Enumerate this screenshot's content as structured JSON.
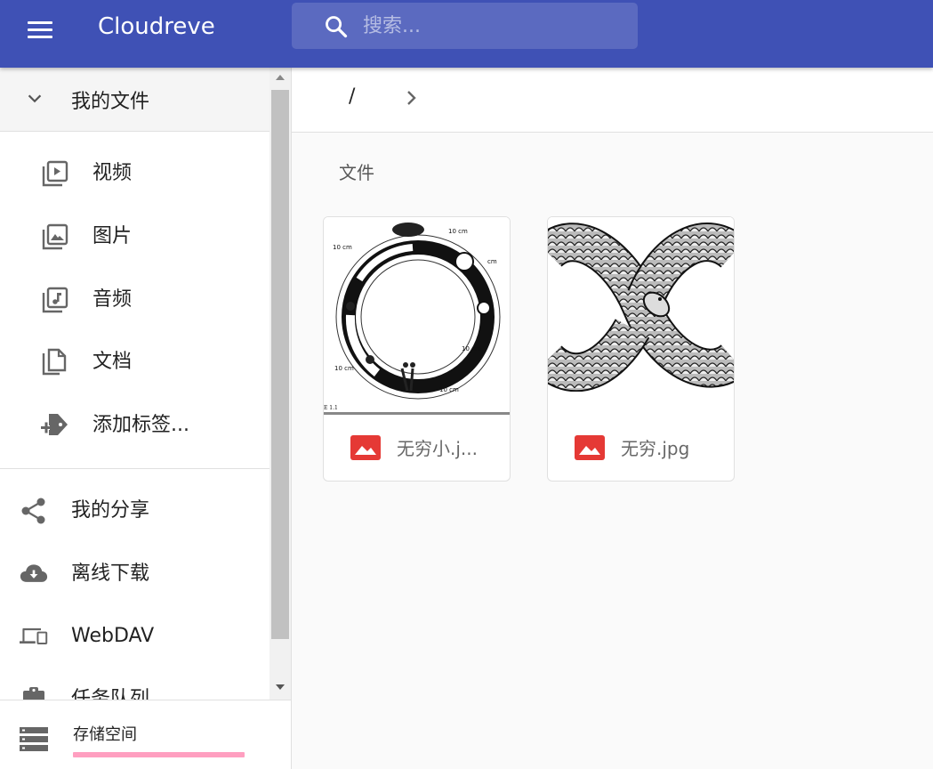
{
  "app": {
    "title": "Cloudreve",
    "accent": "#3f51b5"
  },
  "search": {
    "placeholder": "搜索..."
  },
  "sidebar": {
    "folder_header": "我的文件",
    "sub_items": [
      {
        "label": "视频",
        "icon": "video-library-icon"
      },
      {
        "label": "图片",
        "icon": "photo-library-icon"
      },
      {
        "label": "音频",
        "icon": "music-library-icon"
      },
      {
        "label": "文档",
        "icon": "documents-icon"
      },
      {
        "label": "添加标签...",
        "icon": "add-tag-icon"
      }
    ],
    "main_items": [
      {
        "label": "我的分享",
        "icon": "share-icon"
      },
      {
        "label": "离线下载",
        "icon": "cloud-download-icon"
      },
      {
        "label": "WebDAV",
        "icon": "devices-icon"
      },
      {
        "label": "任务队列",
        "icon": "assignment-icon"
      }
    ],
    "storage": {
      "label": "存储空间",
      "bar_color": "#ff4081"
    }
  },
  "breadcrumb": {
    "root": "/"
  },
  "main": {
    "section_title": "文件",
    "files": [
      {
        "name": "无穷小.j...",
        "type_icon": "image-file-icon",
        "type_color": "#e53935"
      },
      {
        "name": "无穷.jpg",
        "type_icon": "image-file-icon",
        "type_color": "#e53935"
      }
    ]
  }
}
